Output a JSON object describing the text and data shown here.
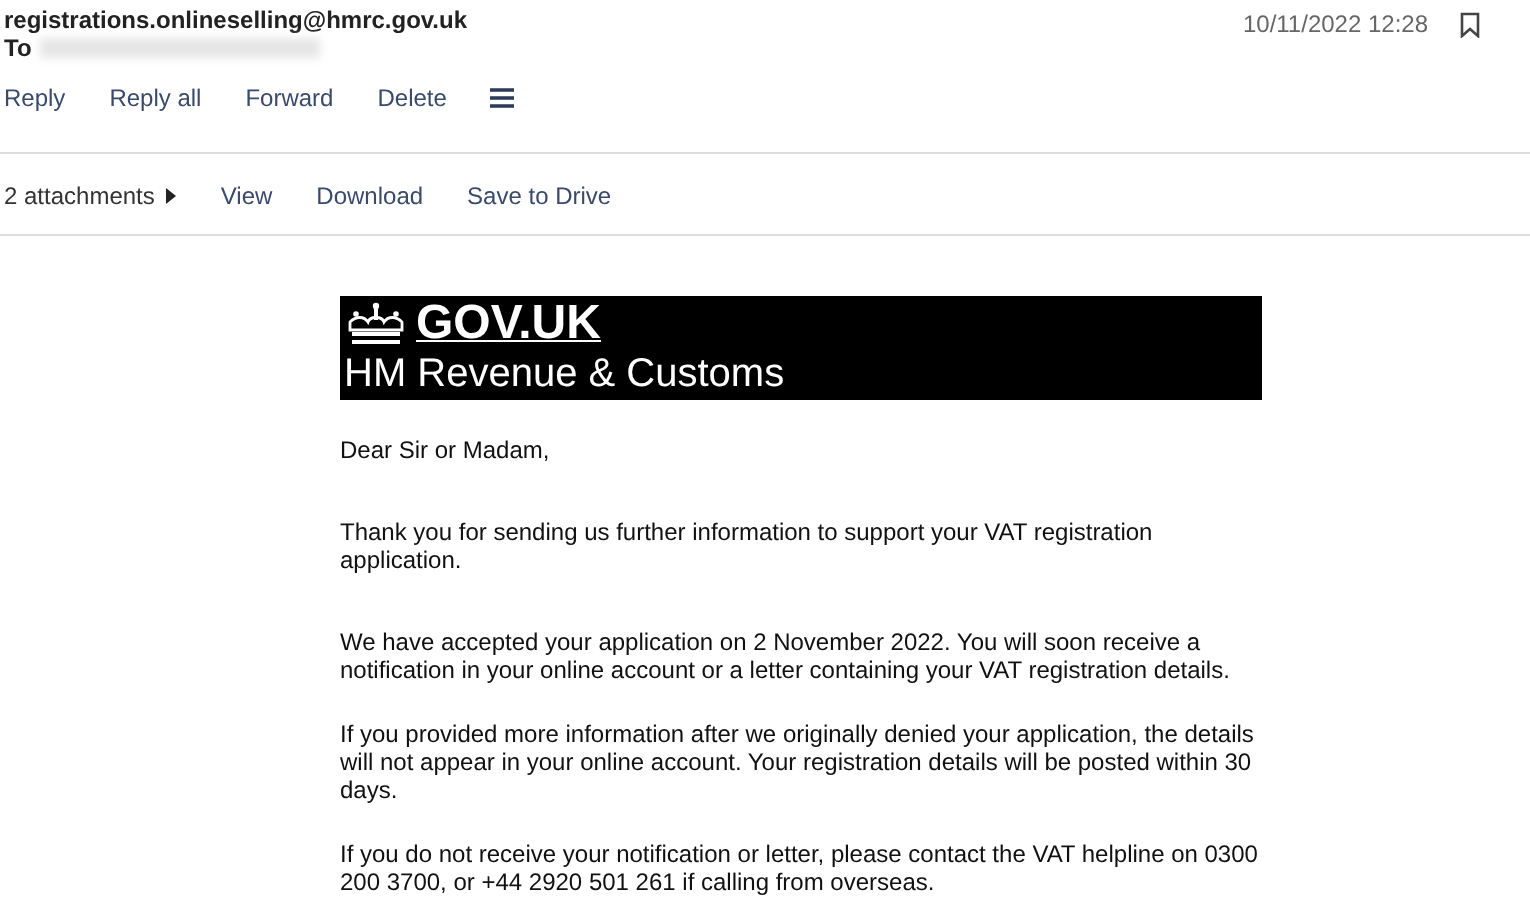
{
  "sender": "registrations.onlineselling@hmrc.gov.uk",
  "to_label": "To",
  "date": "10/11/2022 12:28",
  "actions": [
    "Reply",
    "Reply all",
    "Forward",
    "Delete"
  ],
  "attachments": {
    "count": "2 attachments",
    "actions": [
      "View",
      "Download",
      "Save to Drive"
    ]
  },
  "banner": {
    "logo": "GOV.UK",
    "department": "HM Revenue & Customs"
  },
  "paragraphs": [
    "Dear Sir or Madam,",
    "Thank you for sending us further information to support your VAT registration application.",
    "We have accepted your application on 2 November 2022. You will soon receive a notification in your online account or a letter containing your VAT registration details.",
    "If you provided more information after we originally denied your application, the details will not appear in your online account. Your registration details will be posted within 30 days.",
    "If you do not receive your notification or letter, please contact the VAT helpline on 0300 200 3700, or +44 2920 501 261 if calling from overseas."
  ]
}
